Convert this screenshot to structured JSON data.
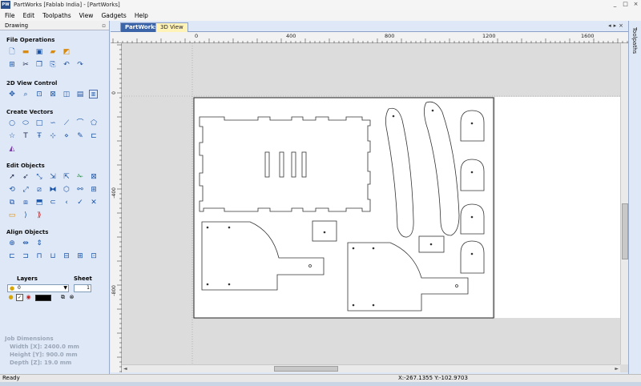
{
  "window": {
    "app_icon_text": "PW",
    "title": "PartWorks [Fablab India] - [PartWorks]",
    "controls": [
      "_",
      "□",
      "×"
    ]
  },
  "menu": [
    "File",
    "Edit",
    "Toolpaths",
    "View",
    "Gadgets",
    "Help"
  ],
  "left_panel": {
    "header": "Drawing",
    "pin": "▫",
    "sections": {
      "file_operations": "File Operations",
      "view_control": "2D View Control",
      "create_vectors": "Create Vectors",
      "edit_objects": "Edit Objects",
      "align_objects": "Align Objects"
    },
    "layers_title": "Layers",
    "sheet_title": "Sheet",
    "layer_value": "0",
    "sheet_value": "1",
    "job_dimensions": {
      "title": "Job Dimensions",
      "width": "Width  [X]: 2400.0 mm",
      "height": "Height [Y]: 900.0 mm",
      "depth": "Depth  [Z]: 19.0 mm"
    }
  },
  "tabs": [
    {
      "label": "PartWorks",
      "active": true
    },
    {
      "label": "3D View",
      "active": false
    }
  ],
  "tab_controls": [
    "◂",
    "▸",
    "×"
  ],
  "right_panel": {
    "label": "Toolpaths"
  },
  "rulers": {
    "top": [
      "0",
      "400",
      "800",
      "1200",
      "1600"
    ],
    "left": [
      "0",
      "-400",
      "-800"
    ]
  },
  "status": {
    "ready": "Ready",
    "coords": "X:-267.1355 Y:-102.9703"
  },
  "colors": {
    "panel_bg": "#dfe8f6",
    "active_tab": "#3c64a8",
    "inactive_tab": "#fff3b8",
    "canvas_bg": "#dcdcdc",
    "sheet": "#ffffff"
  }
}
